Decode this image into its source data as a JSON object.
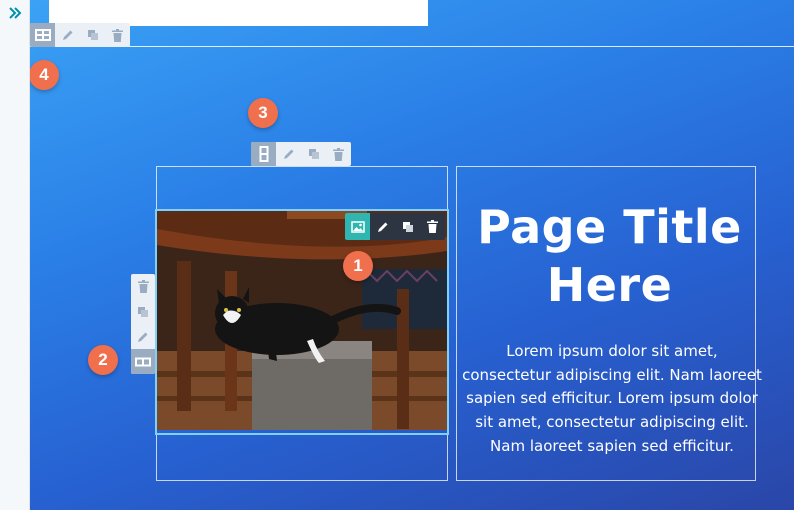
{
  "app": {
    "sidebar_toggle_icon": "chevron-double-right-icon"
  },
  "toolbars": {
    "section": [
      "section-layout-icon",
      "pencil-icon",
      "copy-icon",
      "trash-icon"
    ],
    "column": [
      "column-layout-icon",
      "pencil-icon",
      "copy-icon",
      "trash-icon"
    ],
    "row": [
      "trash-icon",
      "copy-icon",
      "pencil-icon",
      "row-layout-icon"
    ],
    "image_module": [
      "image-icon",
      "pencil-icon",
      "copy-icon",
      "trash-icon"
    ]
  },
  "badges": {
    "one": "1",
    "two": "2",
    "three": "3",
    "four": "4"
  },
  "content": {
    "title": "Page Title Here",
    "body": "Lorem ipsum dolor sit amet, consectetur adipiscing elit. Nam laoreet sapien sed efficitur. Lorem ipsum dolor sit amet, consectetur adipiscing elit. Nam laoreet sapien sed efficitur.",
    "image_alt": "Black and white cat lying under a wooden table"
  },
  "colors": {
    "badge": "#f0704e",
    "active_tool": "#99acc2",
    "image_tool_active": "#2fb6b0",
    "gradient_top": "#3aa2f5",
    "gradient_bottom": "#2a46a8",
    "selection": "#7fd1f7"
  }
}
